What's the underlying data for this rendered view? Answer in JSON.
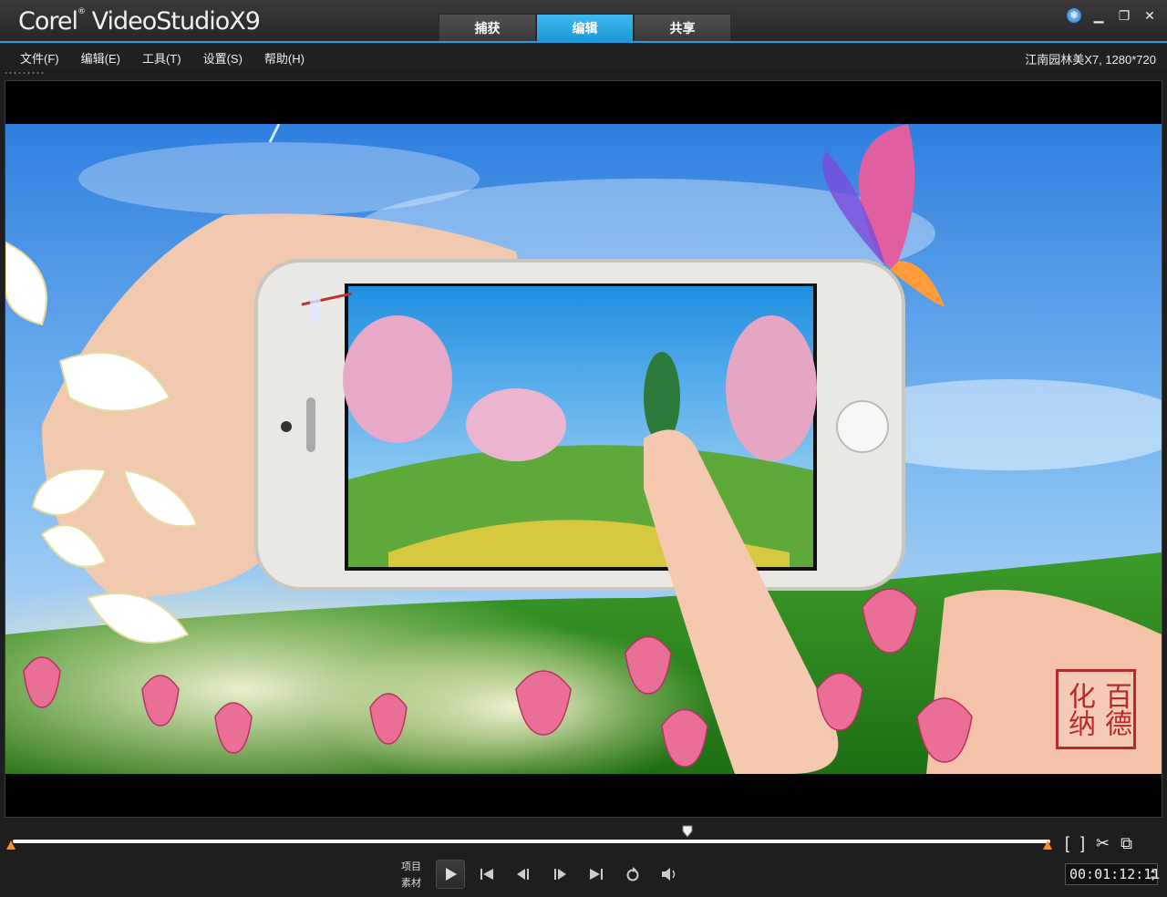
{
  "app": {
    "brand_corel": "Corel",
    "brand_product": "VideoStudio",
    "brand_version": "X9"
  },
  "tabs": [
    {
      "label": "捕获",
      "active": false
    },
    {
      "label": "编辑",
      "active": true
    },
    {
      "label": "共享",
      "active": false
    }
  ],
  "menu": [
    {
      "label": "文件(F)"
    },
    {
      "label": "编辑(E)"
    },
    {
      "label": "工具(T)"
    },
    {
      "label": "设置(S)"
    },
    {
      "label": "帮助(H)"
    }
  ],
  "project_info": "江南园林美X7, 1280*720",
  "preview": {
    "seal_text": "百德化纳",
    "playhead_position": 0.65
  },
  "playback": {
    "mode_project": "项目",
    "mode_clip": "素材",
    "timecode": "00:01:12:11"
  },
  "colors": {
    "accent": "#1d9ee0",
    "marker": "#ff8a1e"
  }
}
